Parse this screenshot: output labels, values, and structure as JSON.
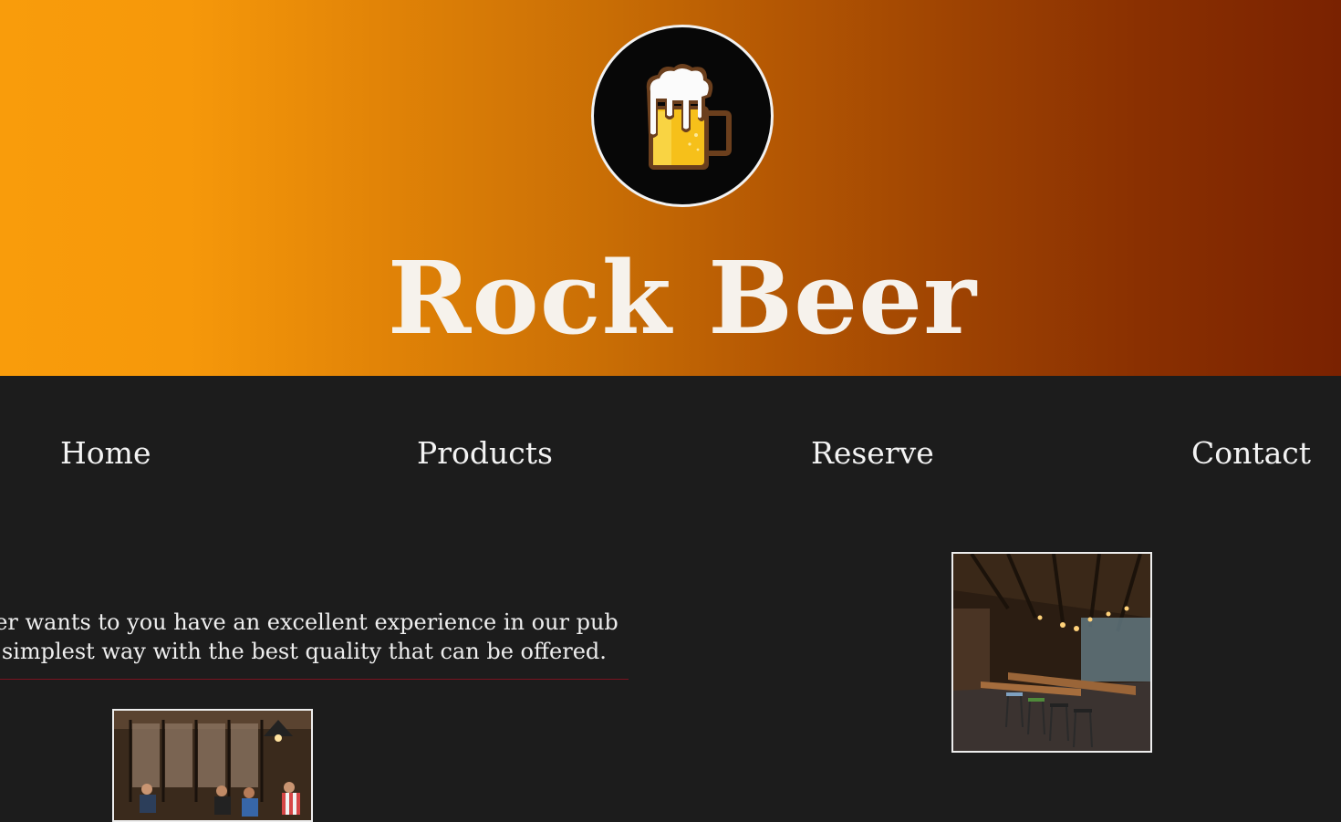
{
  "header": {
    "title": "Rock Beer",
    "logo_icon": "beer-mug-icon",
    "gradient_colors": [
      "#f99c0b",
      "#7a2201"
    ]
  },
  "nav": {
    "items": [
      {
        "label": "Home"
      },
      {
        "label": "Products"
      },
      {
        "label": "Reserve"
      },
      {
        "label": "Contact"
      }
    ]
  },
  "intro": {
    "line1": "eer wants to you have an excellent experience in our pub",
    "line2": "e simplest way with the best quality that can be offered."
  },
  "colors": {
    "background": "#1c1c1c",
    "divider": "#7a1420",
    "text": "#f3f3f3"
  }
}
